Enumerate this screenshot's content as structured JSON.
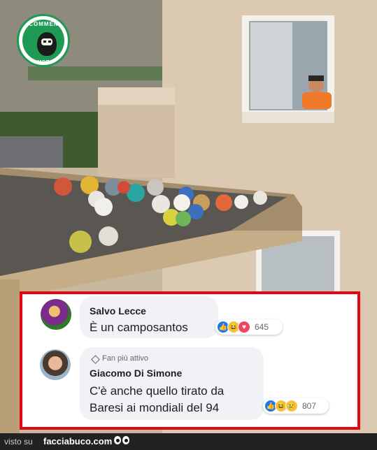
{
  "logo": {
    "top_text": "COMMENTI",
    "bottom_text": "MEMORABILI"
  },
  "comments": [
    {
      "author": "Salvo Lecce",
      "text": "È un camposantos",
      "reaction_count": "645"
    },
    {
      "badge": "Fan più attivo",
      "author": "Giacomo Di Simone",
      "text_line1": "C'è anche quello tirato da",
      "text_line2": "Baresi ai mondiali del 94",
      "reaction_count": "807"
    }
  ],
  "footer": {
    "prefix": "visto su",
    "site": "facciabuco.com"
  },
  "colors": {
    "frame_red": "#e30613",
    "logo_green": "#1f9a55",
    "like_blue": "#1877f2"
  }
}
